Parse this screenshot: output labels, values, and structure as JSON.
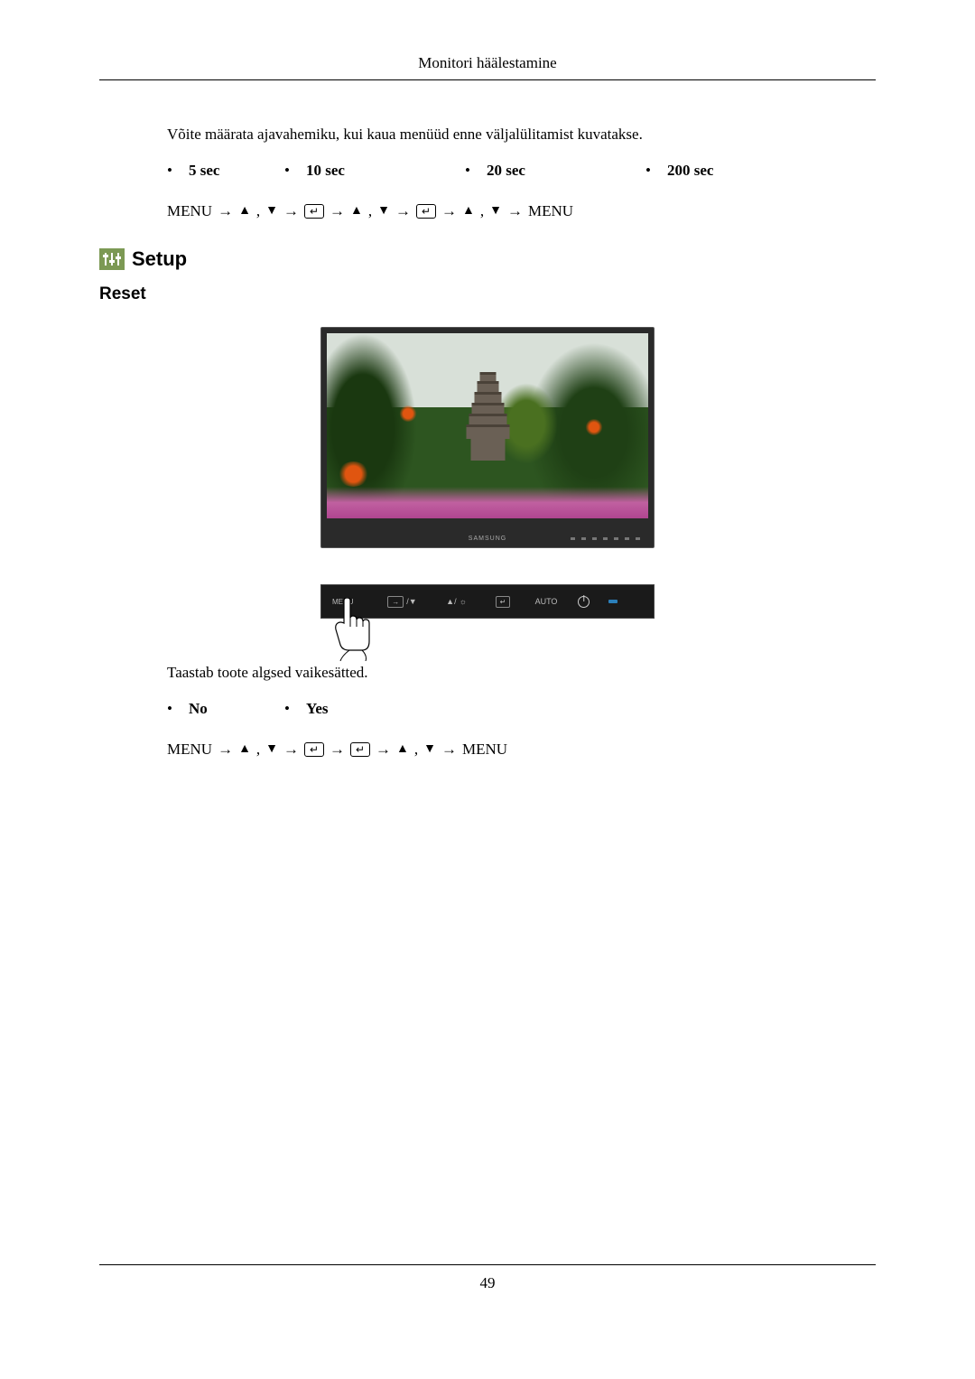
{
  "header": {
    "title": "Monitori häälestamine"
  },
  "intro_text": "Võite määrata ajavahemiku, kui kaua menüüd enne väljalülitamist kuvatakse.",
  "time_options": [
    "5 sec",
    "10 sec",
    "20 sec",
    "200 sec"
  ],
  "sequence1": {
    "menu": "MENU",
    "arrow": "→",
    "up": "▲",
    "down": "▼",
    "sep": ","
  },
  "setup_heading": "Setup",
  "reset_heading": "Reset",
  "monitor": {
    "brand": "SAMSUNG"
  },
  "panel": {
    "menu": "MENU",
    "source_down": "/▼",
    "up_bright": "▲/",
    "auto": "AUTO"
  },
  "body_text2": "Taastab toote algsed vaikesätted.",
  "reset_options": [
    "No",
    "Yes"
  ],
  "page_number": "49"
}
